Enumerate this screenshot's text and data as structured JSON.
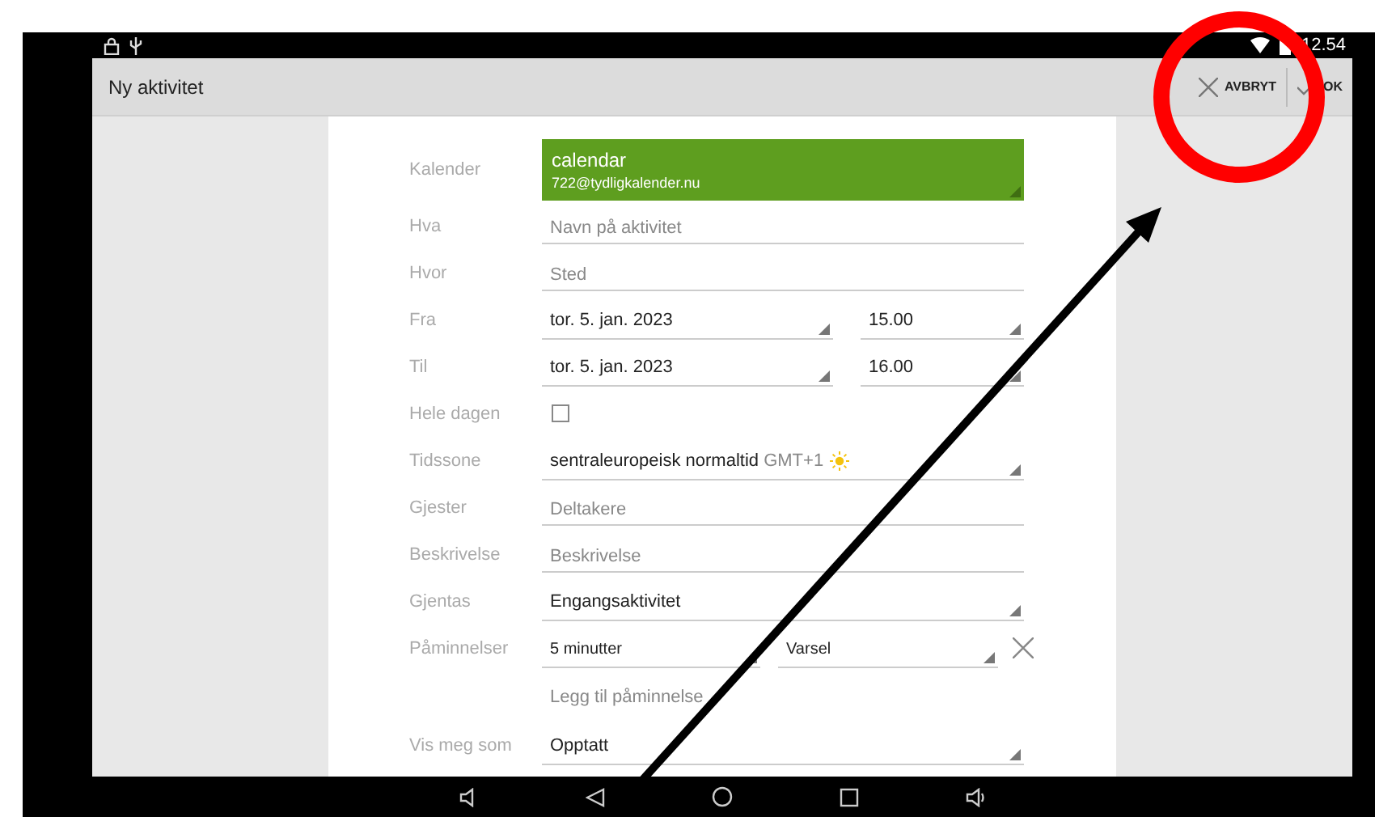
{
  "status_bar": {
    "time": "12.54"
  },
  "toolbar": {
    "title": "Ny aktivitet",
    "cancel": "AVBRYT",
    "ok": "OK"
  },
  "calendar": {
    "label": "Kalender",
    "name": "calendar",
    "account": "722@tydligkalender.nu"
  },
  "rows": [
    {
      "kind": "text",
      "label": "Hva",
      "placeholder": "Navn på aktivitet"
    },
    {
      "kind": "text",
      "label": "Hvor",
      "placeholder": "Sted"
    },
    {
      "kind": "datetime",
      "label": "Fra",
      "date": "tor. 5. jan. 2023",
      "time": "15.00"
    },
    {
      "kind": "datetime",
      "label": "Til",
      "date": "tor. 5. jan. 2023",
      "time": "16.00"
    },
    {
      "kind": "checkbox",
      "label": "Hele dagen",
      "checked": false
    },
    {
      "kind": "timezone",
      "label": "Tidssone",
      "value": "sentraleuropeisk normaltid",
      "offset": "GMT+1"
    },
    {
      "kind": "text",
      "label": "Gjester",
      "placeholder": "Deltakere"
    },
    {
      "kind": "text",
      "label": "Beskrivelse",
      "placeholder": "Beskrivelse"
    },
    {
      "kind": "select",
      "label": "Gjentas",
      "value": "Engangsaktivitet"
    },
    {
      "kind": "reminder",
      "label": "Påminnelser",
      "value": "5 minutter",
      "method": "Varsel"
    },
    {
      "kind": "link",
      "text": "Legg til påminnelse"
    },
    {
      "kind": "select",
      "label": "Vis meg som",
      "value": "Opptatt"
    }
  ]
}
